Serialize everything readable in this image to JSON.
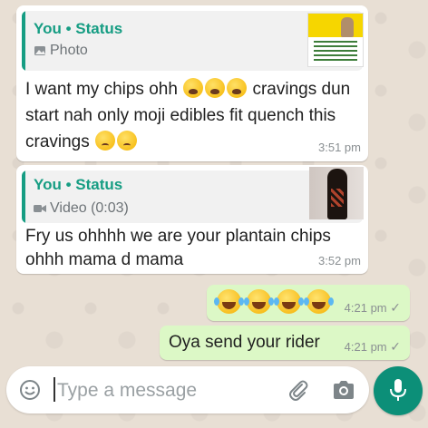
{
  "messages": [
    {
      "direction": "incoming",
      "quote": {
        "author": "You • Status",
        "media_label": "Photo",
        "media_icon": "photo-icon"
      },
      "text_parts": [
        "I want my chips ohh",
        "cravings dun start nah only moji edibles fit quench this cravings"
      ],
      "emojis_after_part1": [
        "weary-face",
        "weary-face",
        "weary-face"
      ],
      "emojis_end": [
        "worried-face",
        "worried-face"
      ],
      "time": "3:51 pm"
    },
    {
      "direction": "incoming",
      "quote": {
        "author": "You • Status",
        "media_label": "Video (0:03)",
        "media_icon": "video-icon"
      },
      "text": "Fry us ohhhh we are your plantain chips ohhh mama d mama",
      "time": "3:52 pm"
    },
    {
      "direction": "outgoing",
      "emojis": [
        "rolling-on-floor-laughing",
        "rolling-on-floor-laughing",
        "rolling-on-floor-laughing",
        "rolling-on-floor-laughing"
      ],
      "time": "4:21 pm",
      "status": "sent"
    },
    {
      "direction": "outgoing",
      "text": "Oya send your rider",
      "time": "4:21 pm",
      "status": "sent"
    }
  ],
  "composer": {
    "placeholder": "Type a message",
    "icons": [
      "emoji-icon",
      "attach-icon",
      "camera-icon"
    ],
    "send_icon": "mic-icon"
  },
  "colors": {
    "incoming_bubble": "#ffffff",
    "outgoing_bubble": "#dcf8c6",
    "quote_accent": "#169d83",
    "mic_button": "#0c8f78",
    "wallpaper": "#e8dfd4"
  }
}
